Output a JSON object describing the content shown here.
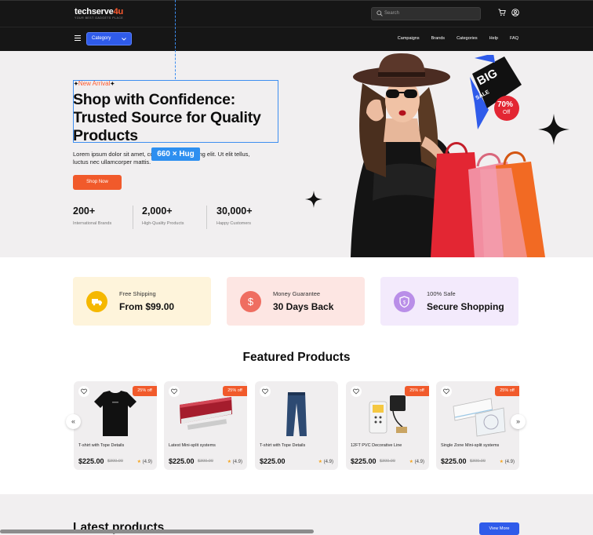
{
  "header": {
    "logo_main": "techserve",
    "logo_accent": "4u",
    "logo_tagline": "YOUR BEST GADGETS PLACE",
    "search_placeholder": "Search",
    "icons": [
      "cart-icon",
      "user-icon"
    ]
  },
  "nav": {
    "category_label": "Category",
    "links": [
      "Campaigns",
      "Brands",
      "Categories",
      "Help",
      "FAQ"
    ]
  },
  "hero": {
    "tag": "New Arrival",
    "title": "Shop with Confidence: Trusted Source for Quality Products",
    "selection_badge": "660 × Hug",
    "description": "Lorem ipsum dolor sit amet, consectetur adipiscing elit. Ut elit tellus, luctus nec ullamcorper mattis.",
    "cta": "Shop Now",
    "stats": [
      {
        "value": "200+",
        "label": "International Brands"
      },
      {
        "value": "2,000+",
        "label": "High-Quality Products"
      },
      {
        "value": "30,000+",
        "label": "Happy Customers"
      }
    ],
    "promo": {
      "big": "BIG",
      "sale": "SALE",
      "pct": "70%",
      "off": "Off"
    }
  },
  "features": [
    {
      "title": "Free Shipping",
      "value": "From $99.00",
      "icon": "truck-icon",
      "bg": "#fef4db",
      "circle": "#f5b800"
    },
    {
      "title": "Money Guarantee",
      "value": "30 Days Back",
      "icon": "dollar-icon",
      "bg": "#fde6e3",
      "circle": "#ef6e61"
    },
    {
      "title": "100% Safe",
      "value": "Secure Shopping",
      "icon": "shield-icon",
      "bg": "#f3eafc",
      "circle": "#b98ee8"
    }
  ],
  "featured": {
    "title": "Featured Products",
    "products": [
      {
        "name": "T-shirt with Tope Details",
        "price": "$225.00",
        "old": "$300.00",
        "rating": "(4.9)",
        "discount": "25% off"
      },
      {
        "name": "Latest Mini-split systems",
        "price": "$225.00",
        "old": "$300.00",
        "rating": "(4.9)",
        "discount": "25% off"
      },
      {
        "name": "T-shirt with Tope Details",
        "price": "$225.00",
        "old": "",
        "rating": "(4.9)",
        "discount": ""
      },
      {
        "name": "12FT PVC Decorative Line",
        "price": "$225.00",
        "old": "$300.00",
        "rating": "(4.9)",
        "discount": "25% off"
      },
      {
        "name": "Single Zone Mini-split systems",
        "price": "$225.00",
        "old": "$300.00",
        "rating": "(4.9)",
        "discount": "25% off"
      }
    ]
  },
  "latest": {
    "title": "Latest products",
    "cta": "View More"
  },
  "colors": {
    "accent": "#f15a2b",
    "primary": "#2f5bea",
    "dark": "#161616"
  }
}
